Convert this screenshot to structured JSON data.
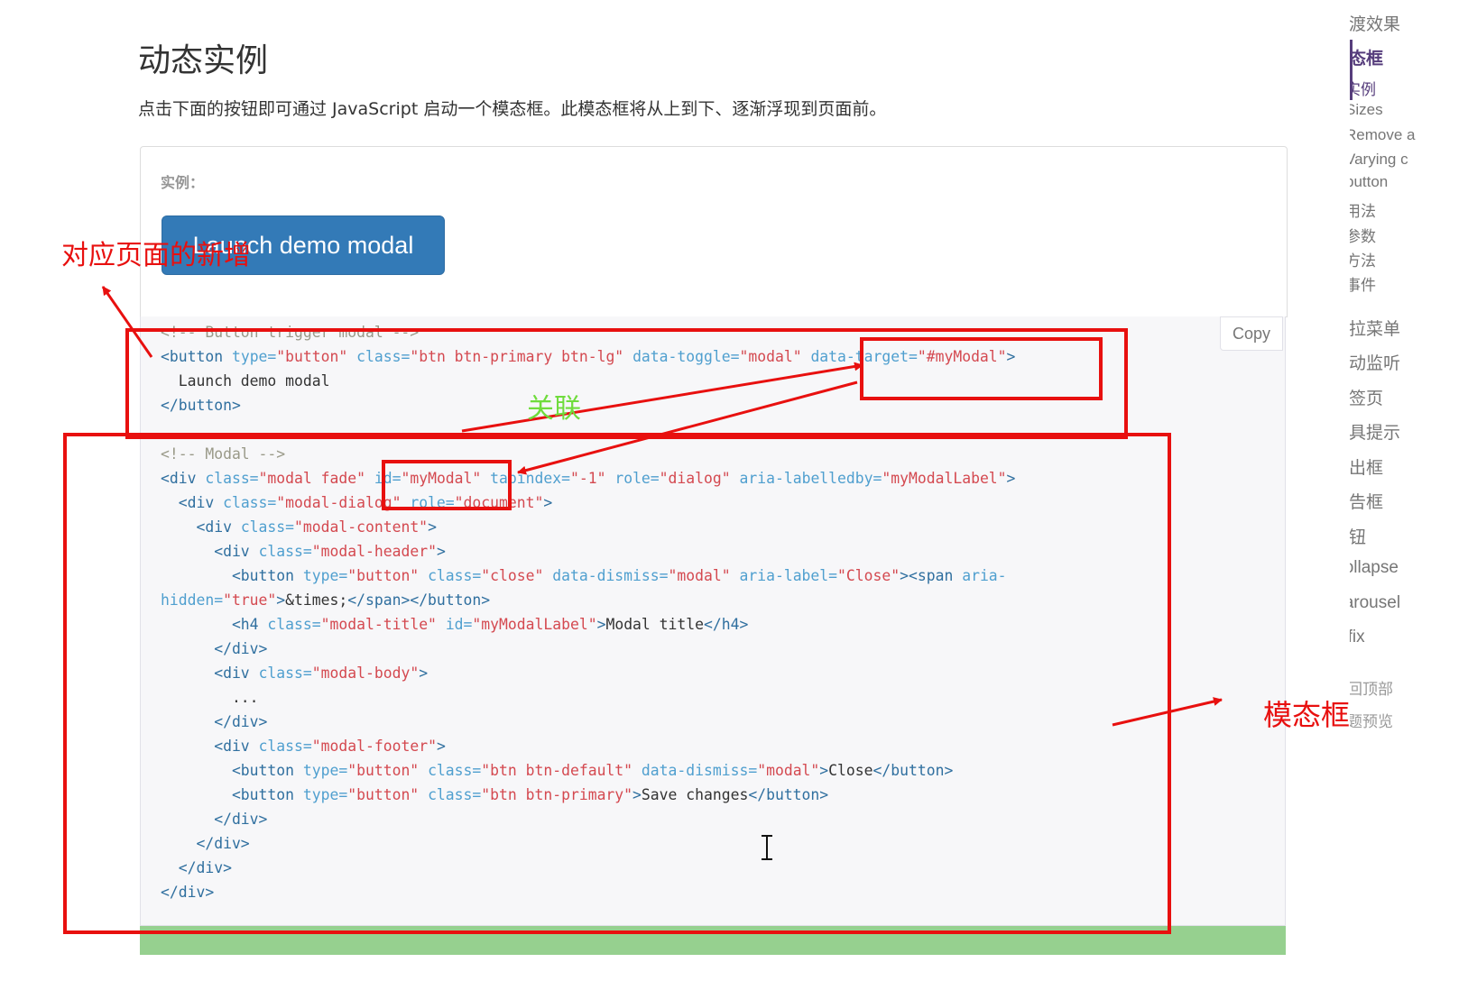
{
  "header": {
    "title": "动态实例",
    "intro": "点击下面的按钮即可通过 JavaScript 启动一个模态框。此模态框将从上到下、逐渐浮现到页面前。"
  },
  "example": {
    "label": "实例：",
    "launch_button": "Launch demo modal",
    "copy_button": "Copy"
  },
  "code_lines": [
    [
      {
        "t": "<!-- Button trigger modal -->",
        "c": "com"
      }
    ],
    [
      {
        "t": "<button ",
        "c": "tag"
      },
      {
        "t": "type=",
        "c": "atn"
      },
      {
        "t": "\"button\"",
        "c": "atv"
      },
      {
        "t": " "
      },
      {
        "t": "class=",
        "c": "atn"
      },
      {
        "t": "\"btn btn-primary btn-lg\"",
        "c": "atv"
      },
      {
        "t": " "
      },
      {
        "t": "data-toggle=",
        "c": "atn"
      },
      {
        "t": "\"modal\"",
        "c": "atv"
      },
      {
        "t": " "
      },
      {
        "t": "data-target=",
        "c": "atn"
      },
      {
        "t": "\"#myModal\"",
        "c": "atv"
      },
      {
        "t": ">",
        "c": "tag"
      }
    ],
    [
      {
        "t": "  Launch demo modal"
      }
    ],
    [
      {
        "t": "</button>",
        "c": "tag"
      }
    ],
    [
      {
        "t": ""
      }
    ],
    [
      {
        "t": "<!-- Modal -->",
        "c": "com"
      }
    ],
    [
      {
        "t": "<div ",
        "c": "tag"
      },
      {
        "t": "class=",
        "c": "atn"
      },
      {
        "t": "\"modal fade\"",
        "c": "atv"
      },
      {
        "t": " "
      },
      {
        "t": "id=",
        "c": "atn"
      },
      {
        "t": "\"myModal\"",
        "c": "atv"
      },
      {
        "t": " "
      },
      {
        "t": "tabindex=",
        "c": "atn"
      },
      {
        "t": "\"-1\"",
        "c": "atv"
      },
      {
        "t": " "
      },
      {
        "t": "role=",
        "c": "atn"
      },
      {
        "t": "\"dialog\"",
        "c": "atv"
      },
      {
        "t": " "
      },
      {
        "t": "aria-labelledby=",
        "c": "atn"
      },
      {
        "t": "\"myModalLabel\"",
        "c": "atv"
      },
      {
        "t": ">",
        "c": "tag"
      }
    ],
    [
      {
        "t": "  <div ",
        "c": "tag"
      },
      {
        "t": "class=",
        "c": "atn"
      },
      {
        "t": "\"modal-dialog\"",
        "c": "atv"
      },
      {
        "t": " "
      },
      {
        "t": "role=",
        "c": "atn"
      },
      {
        "t": "\"document\"",
        "c": "atv"
      },
      {
        "t": ">",
        "c": "tag"
      }
    ],
    [
      {
        "t": "    <div ",
        "c": "tag"
      },
      {
        "t": "class=",
        "c": "atn"
      },
      {
        "t": "\"modal-content\"",
        "c": "atv"
      },
      {
        "t": ">",
        "c": "tag"
      }
    ],
    [
      {
        "t": "      <div ",
        "c": "tag"
      },
      {
        "t": "class=",
        "c": "atn"
      },
      {
        "t": "\"modal-header\"",
        "c": "atv"
      },
      {
        "t": ">",
        "c": "tag"
      }
    ],
    [
      {
        "t": "        <button ",
        "c": "tag"
      },
      {
        "t": "type=",
        "c": "atn"
      },
      {
        "t": "\"button\"",
        "c": "atv"
      },
      {
        "t": " "
      },
      {
        "t": "class=",
        "c": "atn"
      },
      {
        "t": "\"close\"",
        "c": "atv"
      },
      {
        "t": " "
      },
      {
        "t": "data-dismiss=",
        "c": "atn"
      },
      {
        "t": "\"modal\"",
        "c": "atv"
      },
      {
        "t": " "
      },
      {
        "t": "aria-label=",
        "c": "atn"
      },
      {
        "t": "\"Close\"",
        "c": "atv"
      },
      {
        "t": "><span ",
        "c": "tag"
      },
      {
        "t": "aria-",
        "c": "atn"
      }
    ],
    [
      {
        "t": "hidden=",
        "c": "atn"
      },
      {
        "t": "\"true\"",
        "c": "atv"
      },
      {
        "t": ">",
        "c": "tag"
      },
      {
        "t": "&times;"
      },
      {
        "t": "</span></button>",
        "c": "tag"
      }
    ],
    [
      {
        "t": "        <h4 ",
        "c": "tag"
      },
      {
        "t": "class=",
        "c": "atn"
      },
      {
        "t": "\"modal-title\"",
        "c": "atv"
      },
      {
        "t": " "
      },
      {
        "t": "id=",
        "c": "atn"
      },
      {
        "t": "\"myModalLabel\"",
        "c": "atv"
      },
      {
        "t": ">",
        "c": "tag"
      },
      {
        "t": "Modal title"
      },
      {
        "t": "</h4>",
        "c": "tag"
      }
    ],
    [
      {
        "t": "      </div>",
        "c": "tag"
      }
    ],
    [
      {
        "t": "      <div ",
        "c": "tag"
      },
      {
        "t": "class=",
        "c": "atn"
      },
      {
        "t": "\"modal-body\"",
        "c": "atv"
      },
      {
        "t": ">",
        "c": "tag"
      }
    ],
    [
      {
        "t": "        ..."
      }
    ],
    [
      {
        "t": "      </div>",
        "c": "tag"
      }
    ],
    [
      {
        "t": "      <div ",
        "c": "tag"
      },
      {
        "t": "class=",
        "c": "atn"
      },
      {
        "t": "\"modal-footer\"",
        "c": "atv"
      },
      {
        "t": ">",
        "c": "tag"
      }
    ],
    [
      {
        "t": "        <button ",
        "c": "tag"
      },
      {
        "t": "type=",
        "c": "atn"
      },
      {
        "t": "\"button\"",
        "c": "atv"
      },
      {
        "t": " "
      },
      {
        "t": "class=",
        "c": "atn"
      },
      {
        "t": "\"btn btn-default\"",
        "c": "atv"
      },
      {
        "t": " "
      },
      {
        "t": "data-dismiss=",
        "c": "atn"
      },
      {
        "t": "\"modal\"",
        "c": "atv"
      },
      {
        "t": ">",
        "c": "tag"
      },
      {
        "t": "Close"
      },
      {
        "t": "</button>",
        "c": "tag"
      }
    ],
    [
      {
        "t": "        <button ",
        "c": "tag"
      },
      {
        "t": "type=",
        "c": "atn"
      },
      {
        "t": "\"button\"",
        "c": "atv"
      },
      {
        "t": " "
      },
      {
        "t": "class=",
        "c": "atn"
      },
      {
        "t": "\"btn btn-primary\"",
        "c": "atv"
      },
      {
        "t": ">",
        "c": "tag"
      },
      {
        "t": "Save changes"
      },
      {
        "t": "</button>",
        "c": "tag"
      }
    ],
    [
      {
        "t": "      </div>",
        "c": "tag"
      }
    ],
    [
      {
        "t": "    </div>",
        "c": "tag"
      }
    ],
    [
      {
        "t": "  </div>",
        "c": "tag"
      }
    ],
    [
      {
        "t": "</div>",
        "c": "tag"
      }
    ]
  ],
  "sidebar": {
    "items": [
      {
        "label": "过渡效果",
        "active": false
      },
      {
        "label": "模态框",
        "active": true
      },
      {
        "label": "下拉菜单",
        "active": false
      },
      {
        "label": "滚动监听",
        "active": false
      },
      {
        "label": "标签页",
        "active": false
      },
      {
        "label": "工具提示",
        "active": false
      },
      {
        "label": "弹出框",
        "active": false
      },
      {
        "label": "警告框",
        "active": false
      },
      {
        "label": "按钮",
        "active": false
      },
      {
        "label": "Collapse",
        "active": false
      },
      {
        "label": "Carousel",
        "active": false
      },
      {
        "label": "Affix",
        "active": false
      }
    ],
    "subitems": [
      "实例",
      "Sizes",
      "Remove a",
      "Varying c",
      "button",
      "用法",
      "参数",
      "方法",
      "事件"
    ],
    "footer_links": [
      "返回顶部",
      "主题预览"
    ]
  },
  "annotations": {
    "page_new": "对应页面的新增",
    "relation": "关联",
    "modal": "模态框"
  },
  "colors": {
    "annotation_red": "#e8100f",
    "annotation_green": "#6fdc3c",
    "primary_blue": "#337ab7",
    "sidebar_active": "#563d7c",
    "code_bg": "#f7f7f9",
    "green_bar": "#96d08f"
  }
}
